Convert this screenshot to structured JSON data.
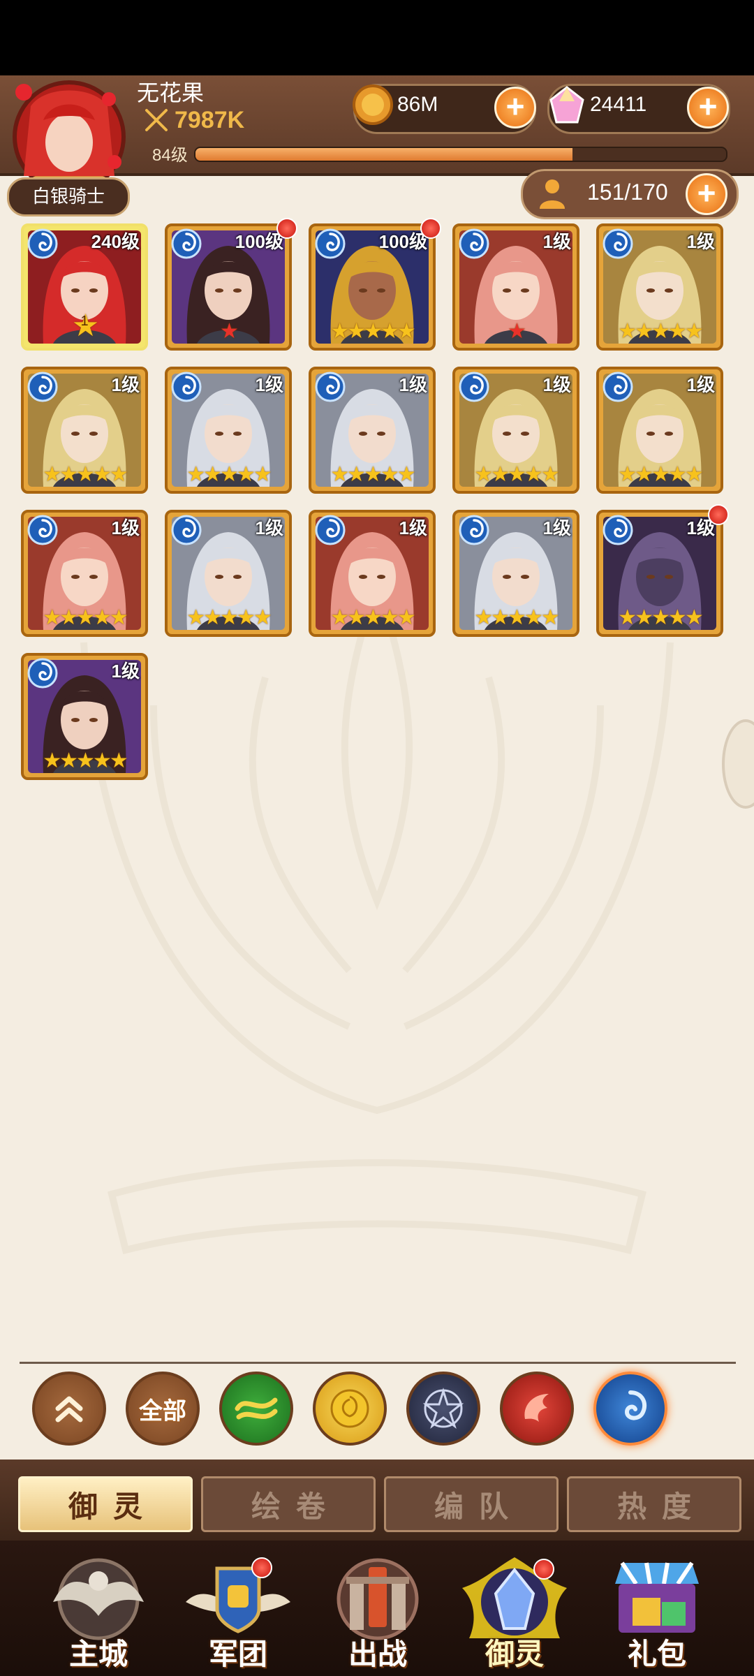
{
  "player": {
    "name": "无花果",
    "power": "7987K",
    "level_label": "84级",
    "level_progress": 0.71,
    "rank": "白银骑士"
  },
  "resources": {
    "gold": "86M",
    "gems": "24411"
  },
  "capacity": "151/170",
  "heroes": [
    {
      "level": "240级",
      "stars": 1,
      "star_color": "gold",
      "selected": true,
      "star_num": "1",
      "badge": false,
      "portrait": "red-hair"
    },
    {
      "level": "100级",
      "stars": 1,
      "star_color": "red",
      "selected": false,
      "badge": true,
      "portrait": "dark-hair"
    },
    {
      "level": "100级",
      "stars": 5,
      "star_color": "gold",
      "selected": false,
      "badge": true,
      "portrait": "gold-crown"
    },
    {
      "level": "1级",
      "stars": 1,
      "star_color": "red",
      "selected": false,
      "badge": false,
      "portrait": "pink-hair"
    },
    {
      "level": "1级",
      "stars": 5,
      "star_color": "gold",
      "selected": false,
      "badge": false,
      "portrait": "blonde"
    },
    {
      "level": "1级",
      "stars": 5,
      "star_color": "gold",
      "selected": false,
      "badge": false,
      "portrait": "blonde"
    },
    {
      "level": "1级",
      "stars": 5,
      "star_color": "gold",
      "selected": false,
      "badge": false,
      "portrait": "silver-hair"
    },
    {
      "level": "1级",
      "stars": 5,
      "star_color": "gold",
      "selected": false,
      "badge": false,
      "portrait": "silver-hair"
    },
    {
      "level": "1级",
      "stars": 5,
      "star_color": "gold",
      "selected": false,
      "badge": false,
      "portrait": "blonde"
    },
    {
      "level": "1级",
      "stars": 5,
      "star_color": "gold",
      "selected": false,
      "badge": false,
      "portrait": "blonde"
    },
    {
      "level": "1级",
      "stars": 5,
      "star_color": "gold",
      "selected": false,
      "badge": false,
      "portrait": "pink-hair"
    },
    {
      "level": "1级",
      "stars": 5,
      "star_color": "gold",
      "selected": false,
      "badge": false,
      "portrait": "silver-hair"
    },
    {
      "level": "1级",
      "stars": 5,
      "star_color": "gold",
      "selected": false,
      "badge": false,
      "portrait": "pink-hair"
    },
    {
      "level": "1级",
      "stars": 5,
      "star_color": "gold",
      "selected": false,
      "badge": false,
      "portrait": "silver-hair"
    },
    {
      "level": "1级",
      "stars": 5,
      "star_color": "gold",
      "selected": false,
      "badge": true,
      "portrait": "dark-mech"
    },
    {
      "level": "1级",
      "stars": 5,
      "star_color": "gold",
      "selected": false,
      "badge": false,
      "portrait": "dark-hair"
    }
  ],
  "filters": {
    "all_label": "全部"
  },
  "tabs": [
    "御灵",
    "绘卷",
    "编队",
    "热度"
  ],
  "nav": [
    "主城",
    "军团",
    "出战",
    "御灵",
    "礼包"
  ],
  "colors": {
    "panel_bg": "#f4ede1",
    "header_brown": "#6b4430",
    "accent_orange": "#e86f12",
    "card_gold": "#e5a43a"
  }
}
